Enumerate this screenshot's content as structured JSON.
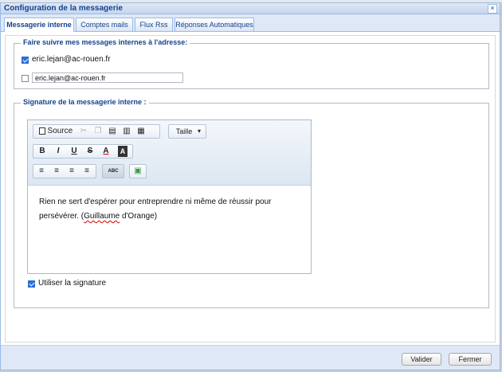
{
  "window": {
    "title": "Configuration de la messagerie",
    "close_label": "×"
  },
  "tabs": [
    {
      "label": "Messagerie interne",
      "active": true
    },
    {
      "label": "Comptes mails",
      "active": false
    },
    {
      "label": "Flux Rss",
      "active": false
    },
    {
      "label": "Réponses Automatiques",
      "active": false
    }
  ],
  "forward": {
    "legend": "Faire suivre mes messages internes à l'adresse:",
    "option1": {
      "label": "eric.lejan@ac-rouen.fr",
      "checked": true
    },
    "option2": {
      "value": "eric.lejan@ac-rouen.fr",
      "checked": false
    }
  },
  "signature": {
    "legend": "Signature de la messagerie interne :",
    "toolbar": {
      "source_label": "Source",
      "size_label": "Taille",
      "size_caret": "▾",
      "bold": "B",
      "italic": "I",
      "underline": "U",
      "strike": "S",
      "text_color": "A",
      "bg_color": "A",
      "align_left": "≡",
      "align_center": "≡",
      "align_right": "≡",
      "justify": "≡",
      "spell_label": "ABC"
    },
    "text_before": "Rien ne sert d'espérer pour entreprendre ni même de réussir pour persévérer. (",
    "text_spell": "Guillaume",
    "text_after": " d'Orange)",
    "use_signature": {
      "label": "Utiliser la signature",
      "checked": true
    }
  },
  "footer": {
    "validate_label": "Valider",
    "close_label": "Fermer"
  },
  "colors": {
    "accent": "#15428b",
    "check": "#2b6fd6"
  }
}
